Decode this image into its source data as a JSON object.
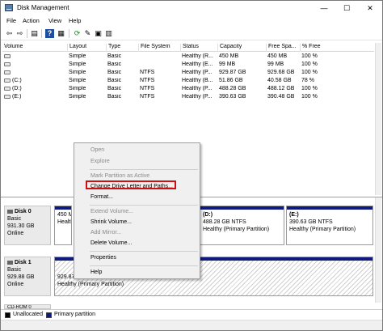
{
  "window": {
    "title": "Disk Management"
  },
  "window_controls": {
    "minimize": "—",
    "maximize": "☐",
    "close": "✕"
  },
  "menu": [
    "File",
    "Action",
    "View",
    "Help"
  ],
  "toolbar": {
    "buttons": [
      {
        "icon": "back-arrow-icon",
        "glyph": "⇦"
      },
      {
        "icon": "forward-arrow-icon",
        "glyph": "⇨"
      },
      {
        "icon": "console-tree-icon",
        "glyph": "▤"
      },
      {
        "icon": "help-icon",
        "glyph": "?"
      },
      {
        "icon": "properties-icon",
        "glyph": "▦"
      },
      {
        "icon": "refresh-icon",
        "glyph": "⟳"
      },
      {
        "icon": "rescan-icon",
        "glyph": "✎"
      },
      {
        "icon": "settings-icon",
        "glyph": "▣"
      },
      {
        "icon": "view-icon",
        "glyph": "▥"
      }
    ]
  },
  "volumes": {
    "columns": [
      "Volume",
      "Layout",
      "Type",
      "File System",
      "Status",
      "Capacity",
      "Free Spa...",
      "% Free"
    ],
    "rows": [
      [
        "",
        "Simple",
        "Basic",
        "",
        "Healthy (R...",
        "450 MB",
        "450 MB",
        "100 %"
      ],
      [
        "",
        "Simple",
        "Basic",
        "",
        "Healthy (E...",
        "99 MB",
        "99 MB",
        "100 %"
      ],
      [
        "",
        "Simple",
        "Basic",
        "NTFS",
        "Healthy (P...",
        "929.87 GB",
        "929.68 GB",
        "100 %"
      ],
      [
        "(C:)",
        "Simple",
        "Basic",
        "NTFS",
        "Healthy (B...",
        "51.86 GB",
        "40.58 GB",
        "78 %"
      ],
      [
        "(D:)",
        "Simple",
        "Basic",
        "NTFS",
        "Healthy (P...",
        "488.28 GB",
        "488.12 GB",
        "100 %"
      ],
      [
        "(E:)",
        "Simple",
        "Basic",
        "NTFS",
        "Healthy (P...",
        "390.63 GB",
        "390.48 GB",
        "100 %"
      ]
    ]
  },
  "disks": [
    {
      "name": "Disk 0",
      "type": "Basic",
      "size": "931.30 GB",
      "status": "Online",
      "partitions": [
        {
          "name": "",
          "size": "450 M",
          "status": "Health"
        },
        {
          "name": "(D:)",
          "size": "488.28 GB NTFS",
          "status": "Healthy (Primary Partition)"
        },
        {
          "name": "(E:)",
          "size": "390.63 GB NTFS",
          "status": "Healthy (Primary Partition)"
        }
      ]
    },
    {
      "name": "Disk 1",
      "type": "Basic",
      "size": "929.88 GB",
      "status": "Online",
      "partitions": [
        {
          "name": "",
          "size": "929.87",
          "status": "Healthy (Primary Partition)"
        }
      ]
    }
  ],
  "cdrom_label": "CD-ROM 0",
  "legend": [
    {
      "label": "Unallocated",
      "color": "#000000"
    },
    {
      "label": "Primary partition",
      "color": "#0f1a7e"
    }
  ],
  "context_menu": {
    "items": [
      {
        "label": "Open",
        "enabled": false
      },
      {
        "label": "Explore",
        "enabled": false
      },
      {
        "label": "Mark Partition as Active",
        "enabled": false
      },
      {
        "label": "Change Drive Letter and Paths...",
        "enabled": true
      },
      {
        "label": "Format...",
        "enabled": true
      },
      {
        "label": "Extend Volume...",
        "enabled": false
      },
      {
        "label": "Shrink Volume...",
        "enabled": true
      },
      {
        "label": "Add Mirror...",
        "enabled": false
      },
      {
        "label": "Delete Volume...",
        "enabled": true
      },
      {
        "label": "Properties",
        "enabled": true
      },
      {
        "label": "Help",
        "enabled": true
      }
    ],
    "highlight_color": "#d01010"
  }
}
